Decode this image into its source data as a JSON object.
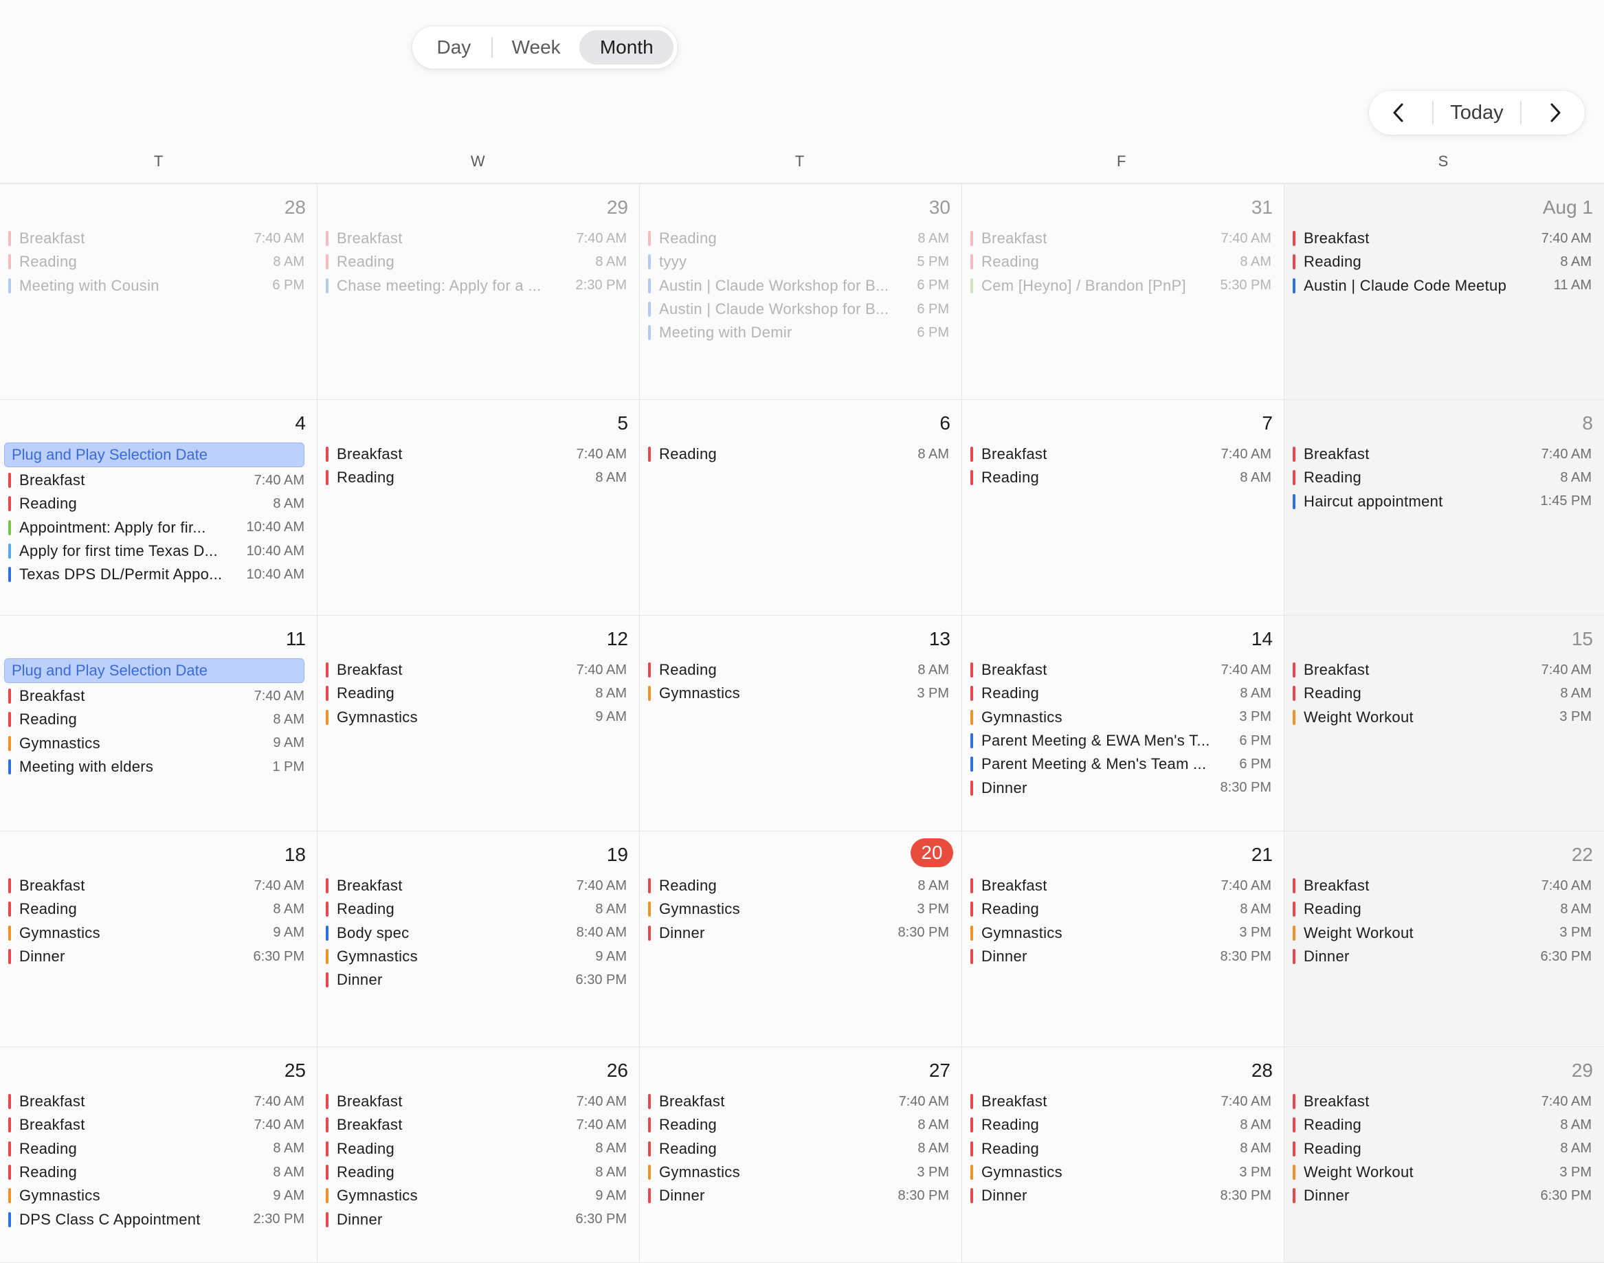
{
  "view_switch": {
    "day": "Day",
    "week": "Week",
    "month": "Month",
    "selected": "Month"
  },
  "nav": {
    "today": "Today",
    "prev_icon": "chevron-left-icon",
    "next_icon": "chevron-right-icon"
  },
  "weekdays": [
    "T",
    "W",
    "T",
    "F",
    "S"
  ],
  "colors": {
    "red": "#e5484d",
    "orange": "#f0922b",
    "blue": "#2f6fe4",
    "lightblue": "#5aa9f0",
    "green": "#7cc24f",
    "today": "#e74c3c"
  },
  "weeks": [
    {
      "days": [
        {
          "date": "28",
          "past": true,
          "events": [
            {
              "title": "Breakfast",
              "time": "7:40 AM",
              "color": "red"
            },
            {
              "title": "Reading",
              "time": "8 AM",
              "color": "red"
            },
            {
              "title": "Meeting with Cousin",
              "time": "6 PM",
              "color": "blue"
            }
          ]
        },
        {
          "date": "29",
          "past": true,
          "events": [
            {
              "title": "Breakfast",
              "time": "7:40 AM",
              "color": "red"
            },
            {
              "title": "Reading",
              "time": "8 AM",
              "color": "red"
            },
            {
              "title": "Chase meeting: Apply for a ...",
              "time": "2:30 PM",
              "color": "blue"
            }
          ]
        },
        {
          "date": "30",
          "past": true,
          "events": [
            {
              "title": "Reading",
              "time": "8 AM",
              "color": "red"
            },
            {
              "title": "tyyy",
              "time": "5 PM",
              "color": "blue"
            },
            {
              "title": "Austin | Claude Workshop for B...",
              "time": "6 PM",
              "color": "blue"
            },
            {
              "title": "Austin | Claude Workshop for B...",
              "time": "6 PM",
              "color": "blue"
            },
            {
              "title": "Meeting with Demir",
              "time": "6 PM",
              "color": "blue"
            }
          ]
        },
        {
          "date": "31",
          "past": true,
          "events": [
            {
              "title": "Breakfast",
              "time": "7:40 AM",
              "color": "red"
            },
            {
              "title": "Reading",
              "time": "8 AM",
              "color": "red"
            },
            {
              "title": "Cem [Heyno] / Brandon [PnP]",
              "time": "5:30 PM",
              "color": "green"
            }
          ]
        },
        {
          "date": "Aug 1",
          "weekend": true,
          "events": [
            {
              "title": "Breakfast",
              "time": "7:40 AM",
              "color": "red"
            },
            {
              "title": "Reading",
              "time": "8 AM",
              "color": "red"
            },
            {
              "title": "Austin | Claude Code Meetup",
              "time": "11 AM",
              "color": "blue"
            }
          ]
        }
      ]
    },
    {
      "days": [
        {
          "date": "4",
          "allday": "Plug and Play Selection Date",
          "events": [
            {
              "title": "Breakfast",
              "time": "7:40 AM",
              "color": "red"
            },
            {
              "title": "Reading",
              "time": "8 AM",
              "color": "red"
            },
            {
              "title": "Appointment: Apply for fir...",
              "time": "10:40 AM",
              "color": "green"
            },
            {
              "title": "Apply for first time Texas D...",
              "time": "10:40 AM",
              "color": "lightblue"
            },
            {
              "title": "Texas DPS DL/Permit Appo...",
              "time": "10:40 AM",
              "color": "blue"
            }
          ]
        },
        {
          "date": "5",
          "events": [
            {
              "title": "Breakfast",
              "time": "7:40 AM",
              "color": "red"
            },
            {
              "title": "Reading",
              "time": "8 AM",
              "color": "red"
            }
          ]
        },
        {
          "date": "6",
          "events": [
            {
              "title": "Reading",
              "time": "8 AM",
              "color": "red"
            }
          ]
        },
        {
          "date": "7",
          "events": [
            {
              "title": "Breakfast",
              "time": "7:40 AM",
              "color": "red"
            },
            {
              "title": "Reading",
              "time": "8 AM",
              "color": "red"
            }
          ]
        },
        {
          "date": "8",
          "weekend": true,
          "events": [
            {
              "title": "Breakfast",
              "time": "7:40 AM",
              "color": "red"
            },
            {
              "title": "Reading",
              "time": "8 AM",
              "color": "red"
            },
            {
              "title": "Haircut appointment",
              "time": "1:45 PM",
              "color": "blue"
            }
          ]
        }
      ]
    },
    {
      "days": [
        {
          "date": "11",
          "allday": "Plug and Play Selection Date",
          "events": [
            {
              "title": "Breakfast",
              "time": "7:40 AM",
              "color": "red"
            },
            {
              "title": "Reading",
              "time": "8 AM",
              "color": "red"
            },
            {
              "title": "Gymnastics",
              "time": "9 AM",
              "color": "orange"
            },
            {
              "title": "Meeting with elders",
              "time": "1 PM",
              "color": "blue"
            }
          ]
        },
        {
          "date": "12",
          "events": [
            {
              "title": "Breakfast",
              "time": "7:40 AM",
              "color": "red"
            },
            {
              "title": "Reading",
              "time": "8 AM",
              "color": "red"
            },
            {
              "title": "Gymnastics",
              "time": "9 AM",
              "color": "orange"
            }
          ]
        },
        {
          "date": "13",
          "events": [
            {
              "title": "Reading",
              "time": "8 AM",
              "color": "red"
            },
            {
              "title": "Gymnastics",
              "time": "3 PM",
              "color": "orange"
            }
          ]
        },
        {
          "date": "14",
          "events": [
            {
              "title": "Breakfast",
              "time": "7:40 AM",
              "color": "red"
            },
            {
              "title": "Reading",
              "time": "8 AM",
              "color": "red"
            },
            {
              "title": "Gymnastics",
              "time": "3 PM",
              "color": "orange"
            },
            {
              "title": "Parent Meeting & EWA Men's T...",
              "time": "6 PM",
              "color": "blue"
            },
            {
              "title": "Parent Meeting & Men's Team ...",
              "time": "6 PM",
              "color": "blue"
            },
            {
              "title": "Dinner",
              "time": "8:30 PM",
              "color": "red"
            }
          ]
        },
        {
          "date": "15",
          "weekend": true,
          "events": [
            {
              "title": "Breakfast",
              "time": "7:40 AM",
              "color": "red"
            },
            {
              "title": "Reading",
              "time": "8 AM",
              "color": "red"
            },
            {
              "title": "Weight Workout",
              "time": "3 PM",
              "color": "orange"
            }
          ]
        }
      ]
    },
    {
      "days": [
        {
          "date": "18",
          "events": [
            {
              "title": "Breakfast",
              "time": "7:40 AM",
              "color": "red"
            },
            {
              "title": "Reading",
              "time": "8 AM",
              "color": "red"
            },
            {
              "title": "Gymnastics",
              "time": "9 AM",
              "color": "orange"
            },
            {
              "title": "Dinner",
              "time": "6:30 PM",
              "color": "red"
            }
          ]
        },
        {
          "date": "19",
          "events": [
            {
              "title": "Breakfast",
              "time": "7:40 AM",
              "color": "red"
            },
            {
              "title": "Reading",
              "time": "8 AM",
              "color": "red"
            },
            {
              "title": "Body spec",
              "time": "8:40 AM",
              "color": "blue"
            },
            {
              "title": "Gymnastics",
              "time": "9 AM",
              "color": "orange"
            },
            {
              "title": "Dinner",
              "time": "6:30 PM",
              "color": "red"
            }
          ]
        },
        {
          "date": "20",
          "today": true,
          "events": [
            {
              "title": "Reading",
              "time": "8 AM",
              "color": "red"
            },
            {
              "title": "Gymnastics",
              "time": "3 PM",
              "color": "orange"
            },
            {
              "title": "Dinner",
              "time": "8:30 PM",
              "color": "red"
            }
          ]
        },
        {
          "date": "21",
          "events": [
            {
              "title": "Breakfast",
              "time": "7:40 AM",
              "color": "red"
            },
            {
              "title": "Reading",
              "time": "8 AM",
              "color": "red"
            },
            {
              "title": "Gymnastics",
              "time": "3 PM",
              "color": "orange"
            },
            {
              "title": "Dinner",
              "time": "8:30 PM",
              "color": "red"
            }
          ]
        },
        {
          "date": "22",
          "weekend": true,
          "events": [
            {
              "title": "Breakfast",
              "time": "7:40 AM",
              "color": "red"
            },
            {
              "title": "Reading",
              "time": "8 AM",
              "color": "red"
            },
            {
              "title": "Weight Workout",
              "time": "3 PM",
              "color": "orange"
            },
            {
              "title": "Dinner",
              "time": "6:30 PM",
              "color": "red"
            }
          ]
        }
      ]
    },
    {
      "days": [
        {
          "date": "25",
          "events": [
            {
              "title": "Breakfast",
              "time": "7:40 AM",
              "color": "red"
            },
            {
              "title": "Breakfast",
              "time": "7:40 AM",
              "color": "red"
            },
            {
              "title": "Reading",
              "time": "8 AM",
              "color": "red"
            },
            {
              "title": "Reading",
              "time": "8 AM",
              "color": "red"
            },
            {
              "title": "Gymnastics",
              "time": "9 AM",
              "color": "orange"
            },
            {
              "title": "DPS Class C Appointment",
              "time": "2:30 PM",
              "color": "blue"
            }
          ]
        },
        {
          "date": "26",
          "events": [
            {
              "title": "Breakfast",
              "time": "7:40 AM",
              "color": "red"
            },
            {
              "title": "Breakfast",
              "time": "7:40 AM",
              "color": "red"
            },
            {
              "title": "Reading",
              "time": "8 AM",
              "color": "red"
            },
            {
              "title": "Reading",
              "time": "8 AM",
              "color": "red"
            },
            {
              "title": "Gymnastics",
              "time": "9 AM",
              "color": "orange"
            },
            {
              "title": "Dinner",
              "time": "6:30 PM",
              "color": "red"
            }
          ]
        },
        {
          "date": "27",
          "events": [
            {
              "title": "Breakfast",
              "time": "7:40 AM",
              "color": "red"
            },
            {
              "title": "Reading",
              "time": "8 AM",
              "color": "red"
            },
            {
              "title": "Reading",
              "time": "8 AM",
              "color": "red"
            },
            {
              "title": "Gymnastics",
              "time": "3 PM",
              "color": "orange"
            },
            {
              "title": "Dinner",
              "time": "8:30 PM",
              "color": "red"
            }
          ]
        },
        {
          "date": "28",
          "events": [
            {
              "title": "Breakfast",
              "time": "7:40 AM",
              "color": "red"
            },
            {
              "title": "Reading",
              "time": "8 AM",
              "color": "red"
            },
            {
              "title": "Reading",
              "time": "8 AM",
              "color": "red"
            },
            {
              "title": "Gymnastics",
              "time": "3 PM",
              "color": "orange"
            },
            {
              "title": "Dinner",
              "time": "8:30 PM",
              "color": "red"
            }
          ]
        },
        {
          "date": "29",
          "weekend": true,
          "events": [
            {
              "title": "Breakfast",
              "time": "7:40 AM",
              "color": "red"
            },
            {
              "title": "Reading",
              "time": "8 AM",
              "color": "red"
            },
            {
              "title": "Reading",
              "time": "8 AM",
              "color": "red"
            },
            {
              "title": "Weight Workout",
              "time": "3 PM",
              "color": "orange"
            },
            {
              "title": "Dinner",
              "time": "6:30 PM",
              "color": "red"
            }
          ]
        }
      ]
    }
  ]
}
